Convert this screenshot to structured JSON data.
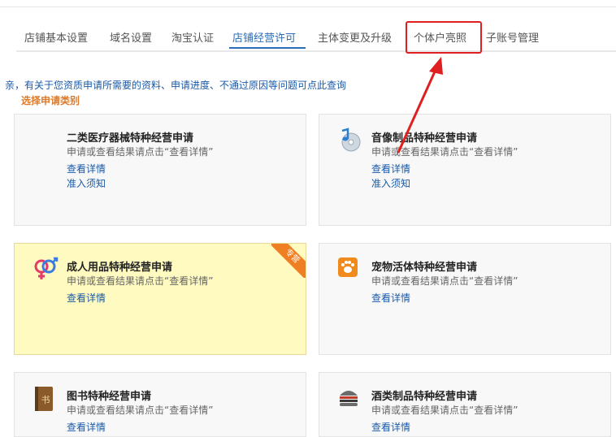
{
  "tabs": [
    {
      "label": "店铺基本设置"
    },
    {
      "label": "域名设置"
    },
    {
      "label": "淘宝认证"
    },
    {
      "label": "店铺经营许可"
    },
    {
      "label": "主体变更及升级"
    },
    {
      "label": "个体户亮照"
    },
    {
      "label": "子账号管理"
    }
  ],
  "active_tab": "店铺经营许可",
  "notice": "亲，有关于您资质申请所需要的资料、申请进度、不通过原因等问题可点此查询",
  "section_title": "选择申请类别",
  "cards": [
    {
      "title": "二类医疗器械特种经营申请",
      "desc": "申请或查看结果请点击“查看详情”",
      "link1": "查看详情",
      "link2": "准入须知"
    },
    {
      "title": "音像制品特种经营申请",
      "desc": "申请或查看结果请点击“查看详情”",
      "link1": "查看详情",
      "link2": "准入须知"
    },
    {
      "title": "成人用品特种经营申请",
      "desc": "申请或查看结果请点击“查看详情”",
      "link1": "查看详情",
      "badge": "专营"
    },
    {
      "title": "宠物活体特种经营申请",
      "desc": "申请或查看结果请点击“查看详情”",
      "link1": "查看详情"
    },
    {
      "title": "图书特种经营申请",
      "desc": "申请或查看结果请点击“查看详情”",
      "link1": "查看详情"
    },
    {
      "title": "酒类制品特种经营申请",
      "desc": "申请或查看结果请点击“查看详情”",
      "link1": "查看详情"
    }
  ],
  "icons": {
    "card_0": "medical-device-icon",
    "card_1": "music-cd-icon",
    "card_2": "gender-symbols-icon",
    "card_3": "paw-icon",
    "card_4": "book-icon",
    "card_5": "burger-icon"
  },
  "book_icon_glyph": "书",
  "colors": {
    "accent": "#2c6bb5",
    "highlight": "#e02020",
    "section_title": "#e07a2a",
    "featured_bg": "#fffabf"
  }
}
